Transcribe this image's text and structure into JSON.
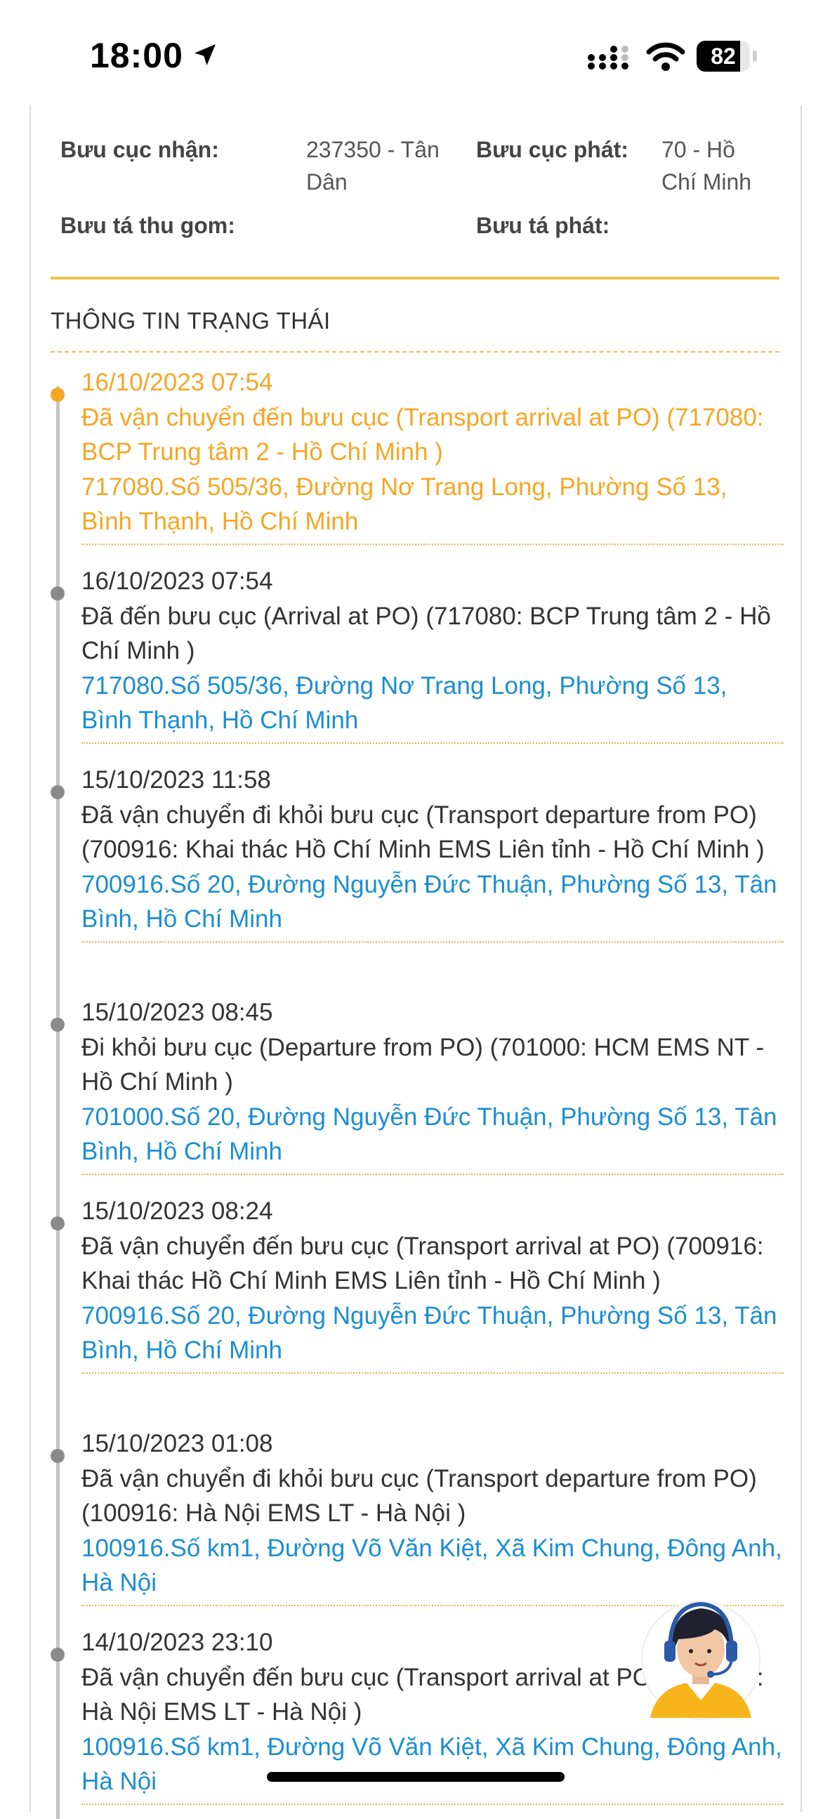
{
  "status_bar": {
    "time": "18:00",
    "battery_percent": "82",
    "battery_level": 0.82,
    "icons": [
      "location-arrow-icon",
      "cellular-signal-icon",
      "wifi-icon",
      "battery-icon"
    ]
  },
  "shipment_info": {
    "receive_office_label": "Bưu cục nhận:",
    "receive_office_value": "237350 - Tân Dân",
    "deliver_office_label": "Bưu cục phát:",
    "deliver_office_value": "70 - Hồ Chí Minh",
    "collect_postman_label": "Bưu tá thu gom:",
    "deliver_postman_label": "Bưu tá phát:"
  },
  "status_section": {
    "title": "THÔNG TIN TRẠNG THÁI",
    "events": [
      {
        "time": "16/10/2023 07:54",
        "description": "Đã vận chuyển đến bưu cục (Transport arrival at PO) (717080: BCP Trung tâm 2 - Hồ Chí Minh )",
        "address": "717080.Số 505/36, Đường Nơ Trang Long, Phường Số 13, Bình Thạnh, Hồ Chí Minh",
        "active": true
      },
      {
        "time": "16/10/2023 07:54",
        "description": "Đã đến bưu cục (Arrival at PO) (717080: BCP Trung tâm 2 - Hồ Chí Minh )",
        "address": "717080.Số 505/36, Đường Nơ Trang Long, Phường Số 13, Bình Thạnh, Hồ Chí Minh"
      },
      {
        "time": "15/10/2023 11:58",
        "description": "Đã vận chuyển đi khỏi bưu cục (Transport departure from PO) (700916: Khai thác Hồ Chí Minh EMS Liên tỉnh - Hồ Chí Minh )",
        "address": "700916.Số 20, Đường Nguyễn Đức Thuận, Phường Số 13, Tân Bình, Hồ Chí Minh"
      },
      {
        "time": "15/10/2023 08:45",
        "description": "Đi khỏi bưu cục (Departure from PO) (701000: HCM EMS NT - Hồ Chí Minh )",
        "address": "701000.Số 20, Đường Nguyễn Đức Thuận, Phường Số 13, Tân Bình, Hồ Chí Minh"
      },
      {
        "time": "15/10/2023 08:24",
        "description": "Đã vận chuyển đến bưu cục (Transport arrival at PO) (700916: Khai thác Hồ Chí Minh EMS Liên tỉnh - Hồ Chí Minh )",
        "address": "700916.Số 20, Đường Nguyễn Đức Thuận, Phường Số 13, Tân Bình, Hồ Chí Minh"
      },
      {
        "time": "15/10/2023 01:08",
        "description": "Đã vận chuyển đi khỏi bưu cục (Transport departure from PO) (100916: Hà Nội EMS LT - Hà Nội )",
        "address": "100916.Số km1, Đường Võ Văn Kiệt, Xã Kim Chung, Đông Anh, Hà Nội"
      },
      {
        "time": "14/10/2023 23:10",
        "description": "Đã vận chuyển đến bưu cục (Transport arrival at PO) (100916: Hà Nội EMS LT - Hà Nội )",
        "address": "100916.Số km1, Đường Võ Văn Kiệt, Xã Kim Chung, Đông Anh, Hà Nội"
      }
    ]
  },
  "support_chat": {
    "icon": "support-agent-avatar-icon"
  },
  "colors": {
    "accent_orange": "#f5a623",
    "divider_gold": "#f0c14b",
    "address_blue": "#1a8ed1",
    "timeline_gray": "#8a8a8a"
  }
}
